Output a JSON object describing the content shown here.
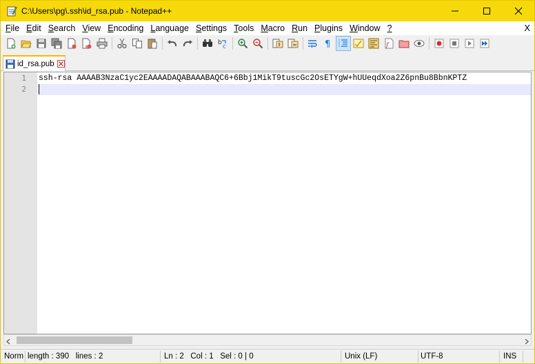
{
  "window": {
    "title": "C:\\Users\\pg\\.ssh\\id_rsa.pub - Notepad++",
    "colors": {
      "titlebar": "#f5d90a",
      "tab_accent": "#f5b800",
      "current_line": "#e8e8ff"
    }
  },
  "menu": {
    "items": [
      {
        "key": "F",
        "rest": "ile"
      },
      {
        "key": "E",
        "rest": "dit"
      },
      {
        "key": "S",
        "rest": "earch"
      },
      {
        "key": "V",
        "rest": "iew"
      },
      {
        "key": "E",
        "rest": "ncoding"
      },
      {
        "key": "L",
        "rest": "anguage"
      },
      {
        "key": "S",
        "rest": "ettings"
      },
      {
        "key": "T",
        "rest": "ools"
      },
      {
        "key": "M",
        "rest": "acro"
      },
      {
        "key": "R",
        "rest": "un"
      },
      {
        "key": "P",
        "rest": "lugins"
      },
      {
        "key": "W",
        "rest": "indow"
      },
      {
        "key": "?",
        "rest": ""
      }
    ],
    "close_label": "X"
  },
  "toolbar": {
    "icons": [
      "new-file-icon",
      "open-file-icon",
      "save-icon",
      "save-all-icon",
      "close-icon",
      "close-all-icon",
      "print-icon",
      "cut-icon",
      "copy-icon",
      "paste-icon",
      "undo-icon",
      "redo-icon",
      "find-icon",
      "replace-icon",
      "zoom-in-icon",
      "zoom-out-icon",
      "sync-vertical-icon",
      "sync-horizontal-icon",
      "word-wrap-icon",
      "show-all-chars-icon",
      "indent-guide-icon",
      "user-lang-icon",
      "doc-map-icon",
      "function-list-icon",
      "folder-workspace-icon",
      "monitoring-icon",
      "record-macro-icon",
      "stop-record-icon",
      "play-macro-icon",
      "run-macro-multiple-icon"
    ]
  },
  "tab": {
    "label": "id_rsa.pub"
  },
  "editor": {
    "lines": [
      {
        "num": "1",
        "text": "ssh-rsa AAAAB3NzaC1yc2EAAAADAQABAAABAQC6+6Bbj1MikT9tuscGc2OsETYgW+hUUeqdXoa2Z6pnBu8BbnKPTZ"
      },
      {
        "num": "2",
        "text": ""
      }
    ]
  },
  "statusbar": {
    "doc_type": "Norm",
    "length": "length : 390",
    "lines": "lines : 2",
    "ln": "Ln : 2",
    "col": "Col : 1",
    "sel": "Sel : 0 | 0",
    "eol": "Unix (LF)",
    "encoding": "UTF-8",
    "mode": "INS"
  }
}
